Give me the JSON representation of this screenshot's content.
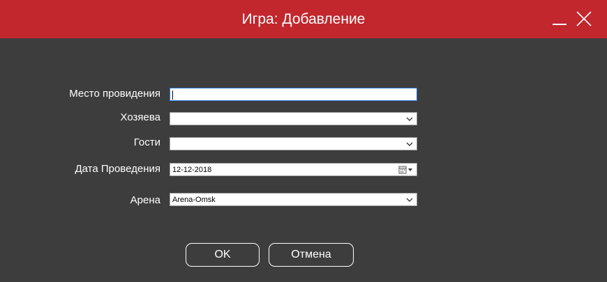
{
  "window": {
    "title": "Игра: Добавление"
  },
  "form": {
    "place": {
      "label": "Место провидения",
      "value": ""
    },
    "hosts": {
      "label": "Хозяева",
      "value": ""
    },
    "guests": {
      "label": "Гости",
      "value": ""
    },
    "date": {
      "label": "Дата Проведения",
      "value": "12-12-2018"
    },
    "arena": {
      "label": "Арена",
      "value": "Arena-Omsk"
    }
  },
  "buttons": {
    "ok": "OK",
    "cancel": "Отмена"
  },
  "colors": {
    "titlebar": "#c1272d",
    "background": "#3d3d3d",
    "focus": "#2b78d6"
  },
  "icons": {
    "minimize": "minimize-icon",
    "close": "close-icon",
    "dropdown": "chevron-down-icon",
    "calendar": "calendar-icon"
  }
}
